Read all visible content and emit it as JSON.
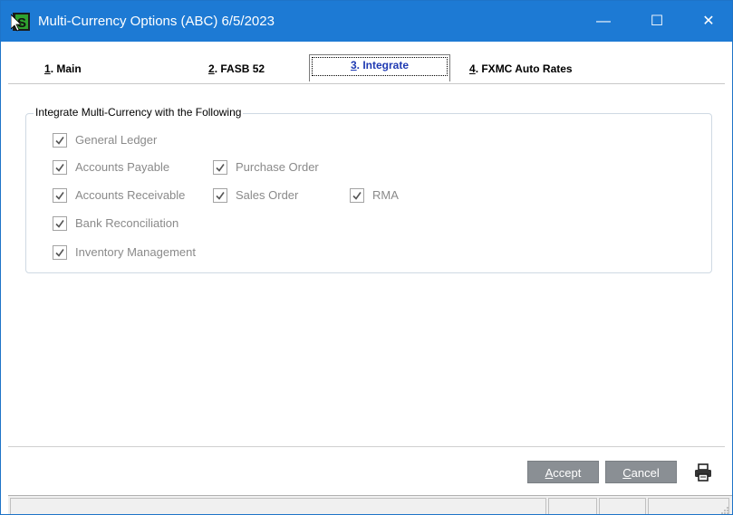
{
  "window": {
    "title": "Multi-Currency Options  (ABC) 6/5/2023",
    "minimize_label": "—",
    "maximize_label": "☐",
    "close_label": "✕"
  },
  "tabs": [
    {
      "key": "1",
      "label": ". Main"
    },
    {
      "key": "2",
      "label": ". FASB 52"
    },
    {
      "key": "3",
      "label": ". Integrate"
    },
    {
      "key": "4",
      "label": ". FXMC Auto Rates"
    }
  ],
  "integrate": {
    "group_title": "Integrate Multi-Currency with the Following",
    "options": {
      "general_ledger": {
        "label": "General Ledger",
        "checked": true
      },
      "accounts_payable": {
        "label": "Accounts Payable",
        "checked": true
      },
      "purchase_order": {
        "label": "Purchase Order",
        "checked": true
      },
      "accounts_receivable": {
        "label": "Accounts Receivable",
        "checked": true
      },
      "sales_order": {
        "label": "Sales Order",
        "checked": true
      },
      "rma": {
        "label": "RMA",
        "checked": true
      },
      "bank_reconciliation": {
        "label": "Bank Reconciliation",
        "checked": true
      },
      "inventory_management": {
        "label": "Inventory Management",
        "checked": true
      }
    }
  },
  "buttons": {
    "accept_key": "A",
    "accept_rest": "ccept",
    "cancel_key": "C",
    "cancel_rest": "ancel"
  },
  "colors": {
    "titlebar": "#1d7ad4",
    "button_bg": "#8a8f94",
    "disabled_text": "#8a8a8a",
    "active_tab_text": "#1f3ab2"
  },
  "icons": {
    "app": "sage-s-icon",
    "print": "printer-icon"
  }
}
